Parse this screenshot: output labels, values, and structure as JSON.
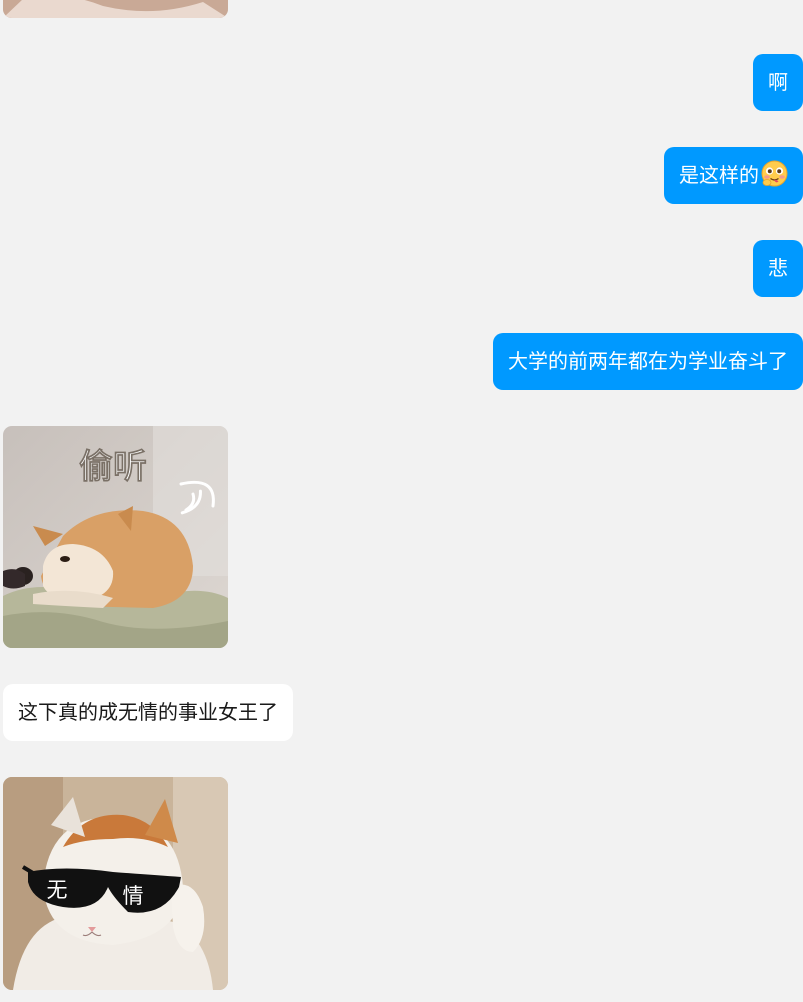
{
  "messages": {
    "m1": "啊",
    "m2": "是这样的",
    "m3": "悲",
    "m4": "大学的前两年都在为学业奋斗了",
    "m5": "这下真的成无情的事业女王了"
  },
  "stickers": {
    "dog_caption": "偷听",
    "cat_caption_left": "无",
    "cat_caption_right": "情"
  },
  "colors": {
    "outgoing_bubble": "#0099ff",
    "incoming_bubble": "#ffffff",
    "background": "#f2f2f2"
  },
  "icons": {
    "m2_emoji": "yummy-face-emoji"
  }
}
